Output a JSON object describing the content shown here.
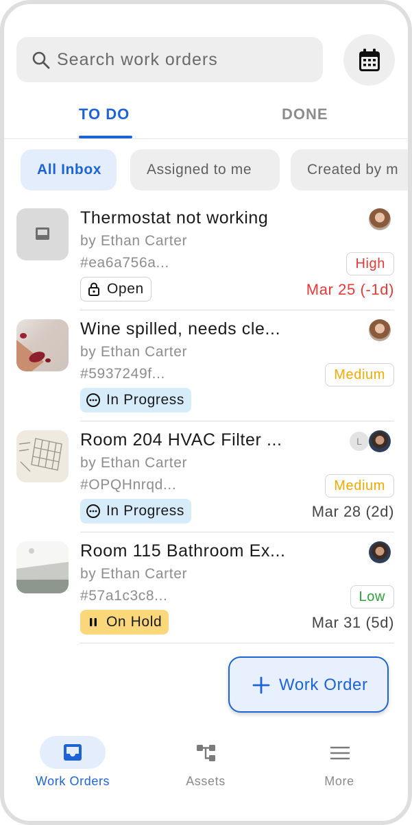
{
  "search": {
    "placeholder": "Search work orders",
    "icon": "search-icon"
  },
  "calendar_button": {
    "icon": "calendar-icon"
  },
  "tabs": [
    {
      "label": "TO DO",
      "active": true
    },
    {
      "label": "DONE",
      "active": false
    }
  ],
  "filters": [
    {
      "label": "All Inbox",
      "active": true
    },
    {
      "label": "Assigned to me",
      "active": false
    },
    {
      "label": "Created by m",
      "active": false
    }
  ],
  "work_orders": [
    {
      "title": "Thermostat not working",
      "author": "by Ethan Carter",
      "id": "#ea6a756a...",
      "status": "Open",
      "status_icon": "lock-icon",
      "priority": "High",
      "due": "Mar 25 (-1d)"
    },
    {
      "title": "Wine spilled, needs cle...",
      "author": "by Ethan Carter",
      "id": "#5937249f...",
      "status": "In Progress",
      "status_icon": "ellipsis-circle-icon",
      "priority": "Medium",
      "due": ""
    },
    {
      "title": "Room 204 HVAC Filter ...",
      "author": "by Ethan Carter",
      "id": "#OPQHnrqd...",
      "status": "In Progress",
      "status_icon": "ellipsis-circle-icon",
      "priority": "Medium",
      "due": "Mar 28 (2d)",
      "extra_assignee_initial": "L"
    },
    {
      "title": "Room 115 Bathroom Ex...",
      "author": "by Ethan Carter",
      "id": "#57a1c3c8...",
      "status": "On Hold",
      "status_icon": "pause-icon",
      "priority": "Low",
      "due": "Mar 31 (5d)"
    }
  ],
  "fab": {
    "label": "Work Order",
    "icon": "plus-icon"
  },
  "bottom_nav": [
    {
      "label": "Work Orders",
      "icon": "inbox-icon",
      "active": true
    },
    {
      "label": "Assets",
      "icon": "hierarchy-icon",
      "active": false
    },
    {
      "label": "More",
      "icon": "menu-icon",
      "active": false
    }
  ],
  "colors": {
    "accent": "#1e63d6",
    "high": "#e53935",
    "medium": "#f2a900",
    "low": "#2e9e3a",
    "in_progress_bg": "#d7ecfb",
    "on_hold_bg": "#f9d77a"
  }
}
